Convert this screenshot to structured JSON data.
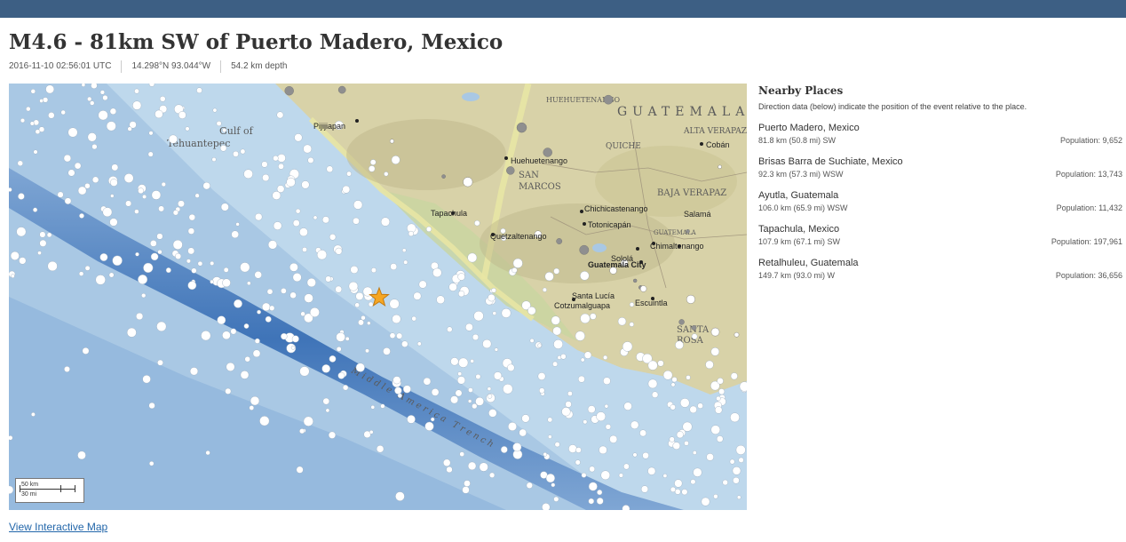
{
  "event": {
    "title": "M4.6 - 81km SW of Puerto Madero, Mexico",
    "time": "2016-11-10 02:56:01 UTC",
    "coords": "14.298°N  93.044°W",
    "depth": "54.2 km depth"
  },
  "map": {
    "labels": {
      "gulf1": "Gulf of",
      "gulf2": "Tehuantepec",
      "guatemala": "GUATEMALA",
      "trench": "Middle America Trench",
      "altaverapaz": "ALTA VERAPAZ",
      "bajaverapaz": "BAJA VERAPAZ",
      "quiche": "QUICHE",
      "huehuetenango_dept": "HUEHUETENANGO",
      "sanmarcos1": "SAN",
      "sanmarcos2": "MARCOS",
      "santarosa1": "SANTA",
      "santarosa2": "ROSA",
      "guatemala_dept": "GUATEMALA"
    },
    "cities": {
      "pijijiapan": "Pijijiapan",
      "huehuetenango": "Huehuetenango",
      "coban": "Cobán",
      "tapachula": "Tapachula",
      "quetzaltenango": "Quetzaltenango",
      "chichicastenango": "Chichicastenango",
      "totonicapan": "Totonicapán",
      "chimaltenango": "Chimaltenango",
      "guatemala_city": "Guatemala City",
      "santa_lucia1": "Santa Lucía",
      "santa_lucia2": "Cotzumalguapa",
      "escuintla": "Escuintla",
      "salama": "Salamá",
      "solola": "Sololá"
    },
    "scale": {
      "km": "50 km",
      "mi": "30 mi"
    },
    "link": "View Interactive Map",
    "colors": {
      "ocean": "#a9c8e4",
      "land": "#d8d2a8",
      "mexico_border": "#e8e5a4",
      "trench": "#4a7fbf",
      "event_star": "#f5a623"
    }
  },
  "nearby": {
    "heading": "Nearby Places",
    "note": "Direction data (below) indicate the position of the event relative to the place.",
    "places": [
      {
        "name": "Puerto Madero, Mexico",
        "distance": "81.8 km (50.8 mi) SW",
        "population": "Population: 9,652"
      },
      {
        "name": "Brisas Barra de Suchiate, Mexico",
        "distance": "92.3 km (57.3 mi) WSW",
        "population": "Population: 13,743"
      },
      {
        "name": "Ayutla, Guatemala",
        "distance": "106.0 km (65.9 mi) WSW",
        "population": "Population: 11,432"
      },
      {
        "name": "Tapachula, Mexico",
        "distance": "107.9 km (67.1 mi) SW",
        "population": "Population: 197,961"
      },
      {
        "name": "Retalhuleu, Guatemala",
        "distance": "149.7 km (93.0 mi) W",
        "population": "Population: 36,656"
      }
    ]
  }
}
